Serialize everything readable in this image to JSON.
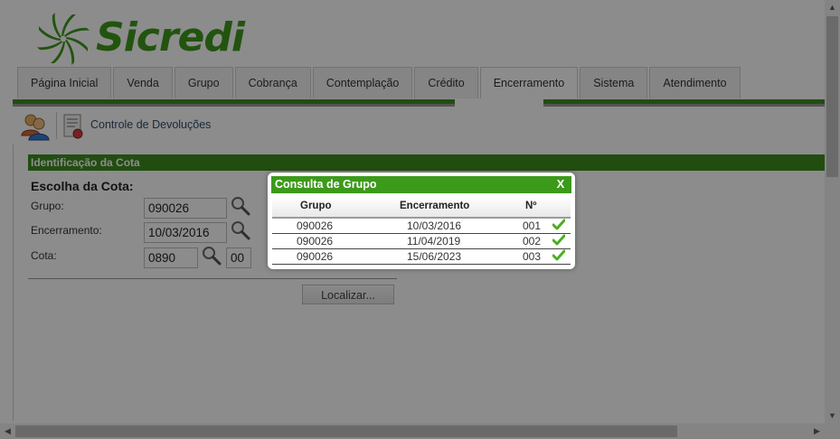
{
  "brand": {
    "name": "Sicredi"
  },
  "tabs": [
    "Página Inicial",
    "Venda",
    "Grupo",
    "Cobrança",
    "Contemplação",
    "Crédito",
    "Encerramento",
    "Sistema",
    "Atendimento"
  ],
  "active_tab": "Encerramento",
  "toolbar": {
    "label": "Controle de Devoluções"
  },
  "section": {
    "title": "Identificação da Cota",
    "subtitle": "Escolha da Cota:",
    "grupo_label": "Grupo:",
    "grupo_value": "090026",
    "encerramento_label": "Encerramento:",
    "encerramento_value": "10/03/2016",
    "cota_label": "Cota:",
    "cota_value": "0890",
    "cota_digit": "00",
    "localizar": "Localizar..."
  },
  "modal": {
    "title": "Consulta de Grupo",
    "close": "X",
    "columns": [
      "Grupo",
      "Encerramento",
      "Nº"
    ],
    "rows": [
      {
        "grupo": "090026",
        "encerramento": "10/03/2016",
        "numero": "001"
      },
      {
        "grupo": "090026",
        "encerramento": "11/04/2019",
        "numero": "002"
      },
      {
        "grupo": "090026",
        "encerramento": "15/06/2023",
        "numero": "003"
      }
    ]
  },
  "colors": {
    "brand_green": "#3f9a1d",
    "bar_green": "#3f8c1f",
    "check_green": "#4caf1f"
  }
}
